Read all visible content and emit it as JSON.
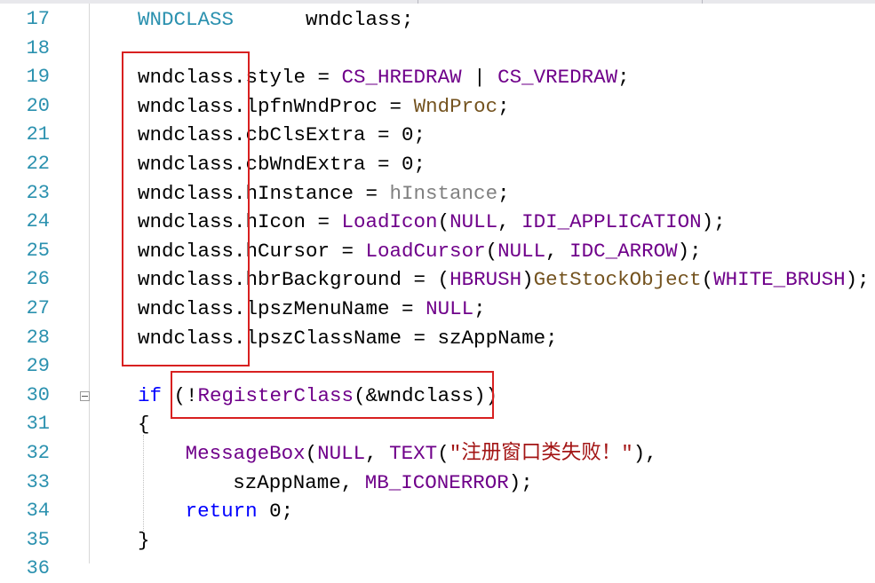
{
  "editor": {
    "lines": [
      {
        "num": "17",
        "tokens": [
          {
            "t": "WNDCLASS",
            "c": "t-type"
          },
          {
            "t": "      wndclass;",
            "c": ""
          }
        ]
      },
      {
        "num": "18",
        "tokens": []
      },
      {
        "num": "19",
        "tokens": [
          {
            "t": "wndclass.style = ",
            "c": ""
          },
          {
            "t": "CS_HREDRAW",
            "c": "t-macro"
          },
          {
            "t": " | ",
            "c": ""
          },
          {
            "t": "CS_VREDRAW",
            "c": "t-macro"
          },
          {
            "t": ";",
            "c": ""
          }
        ]
      },
      {
        "num": "20",
        "tokens": [
          {
            "t": "wndclass.lpfnWndProc = ",
            "c": ""
          },
          {
            "t": "WndProc",
            "c": "t-func"
          },
          {
            "t": ";",
            "c": ""
          }
        ]
      },
      {
        "num": "21",
        "tokens": [
          {
            "t": "wndclass.cbClsExtra = 0;",
            "c": ""
          }
        ]
      },
      {
        "num": "22",
        "tokens": [
          {
            "t": "wndclass.cbWndExtra = 0;",
            "c": ""
          }
        ]
      },
      {
        "num": "23",
        "tokens": [
          {
            "t": "wndclass.hInstance = ",
            "c": ""
          },
          {
            "t": "hInstance",
            "c": "t-param"
          },
          {
            "t": ";",
            "c": ""
          }
        ]
      },
      {
        "num": "24",
        "tokens": [
          {
            "t": "wndclass.hIcon = ",
            "c": ""
          },
          {
            "t": "LoadIcon",
            "c": "t-macro"
          },
          {
            "t": "(",
            "c": ""
          },
          {
            "t": "NULL",
            "c": "t-macro"
          },
          {
            "t": ", ",
            "c": ""
          },
          {
            "t": "IDI_APPLICATION",
            "c": "t-macro"
          },
          {
            "t": ");",
            "c": ""
          }
        ]
      },
      {
        "num": "25",
        "tokens": [
          {
            "t": "wndclass.hCursor = ",
            "c": ""
          },
          {
            "t": "LoadCursor",
            "c": "t-macro"
          },
          {
            "t": "(",
            "c": ""
          },
          {
            "t": "NULL",
            "c": "t-macro"
          },
          {
            "t": ", ",
            "c": ""
          },
          {
            "t": "IDC_ARROW",
            "c": "t-macro"
          },
          {
            "t": ");",
            "c": ""
          }
        ]
      },
      {
        "num": "26",
        "tokens": [
          {
            "t": "wndclass.hbrBackground = (",
            "c": ""
          },
          {
            "t": "HBRUSH",
            "c": "t-macro"
          },
          {
            "t": ")",
            "c": ""
          },
          {
            "t": "GetStockObject",
            "c": "t-func"
          },
          {
            "t": "(",
            "c": ""
          },
          {
            "t": "WHITE_BRUSH",
            "c": "t-macro"
          },
          {
            "t": ");",
            "c": ""
          }
        ]
      },
      {
        "num": "27",
        "tokens": [
          {
            "t": "wndclass.lpszMenuName = ",
            "c": ""
          },
          {
            "t": "NULL",
            "c": "t-macro"
          },
          {
            "t": ";",
            "c": ""
          }
        ]
      },
      {
        "num": "28",
        "tokens": [
          {
            "t": "wndclass.lpszClassName = szAppName;",
            "c": ""
          }
        ]
      },
      {
        "num": "29",
        "tokens": []
      },
      {
        "num": "30",
        "fold": true,
        "tokens": [
          {
            "t": "if",
            "c": "t-kw"
          },
          {
            "t": " (!",
            "c": ""
          },
          {
            "t": "RegisterClass",
            "c": "t-macro"
          },
          {
            "t": "(&wndclass))",
            "c": ""
          }
        ]
      },
      {
        "num": "31",
        "tokens": [
          {
            "t": "{",
            "c": ""
          }
        ]
      },
      {
        "num": "32",
        "indent": 2,
        "tokens": [
          {
            "t": "MessageBox",
            "c": "t-macro"
          },
          {
            "t": "(",
            "c": ""
          },
          {
            "t": "NULL",
            "c": "t-macro"
          },
          {
            "t": ", ",
            "c": ""
          },
          {
            "t": "TEXT",
            "c": "t-macro"
          },
          {
            "t": "(",
            "c": ""
          },
          {
            "t": "\"注册窗口类失败！\"",
            "c": "t-str"
          },
          {
            "t": "),",
            "c": ""
          }
        ]
      },
      {
        "num": "33",
        "indent": 4,
        "tokens": [
          {
            "t": "szAppName, ",
            "c": ""
          },
          {
            "t": "MB_ICONERROR",
            "c": "t-macro"
          },
          {
            "t": ");",
            "c": ""
          }
        ]
      },
      {
        "num": "34",
        "indent": 2,
        "tokens": [
          {
            "t": "return",
            "c": "t-kw"
          },
          {
            "t": " 0;",
            "c": ""
          }
        ]
      },
      {
        "num": "35",
        "tokens": [
          {
            "t": "}",
            "c": ""
          }
        ]
      },
      {
        "num": "36",
        "tokens": []
      }
    ]
  },
  "colors": {
    "line_number": "#2b91af",
    "keyword": "#0000ff",
    "macro": "#6f008a",
    "function": "#74531f",
    "parameter": "#808080",
    "string": "#a31515",
    "highlight_box": "#d82020"
  }
}
